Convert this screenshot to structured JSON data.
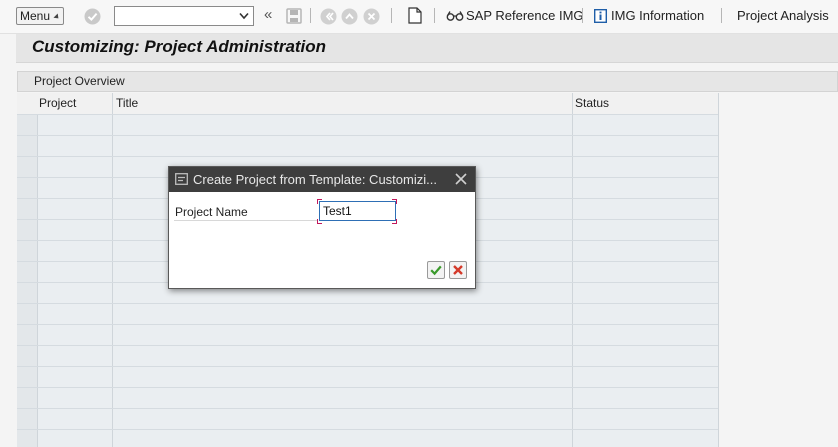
{
  "toolbar": {
    "menu_label": "Menu",
    "command_field_value": "",
    "sap_reference_label": "SAP Reference IMG",
    "img_information_label": "IMG Information",
    "project_analysis_label": "Project Analysis"
  },
  "page": {
    "title": "Customizing: Project Administration"
  },
  "overview": {
    "section_title": "Project Overview",
    "columns": [
      "Project",
      "Title",
      "Status"
    ],
    "rows": []
  },
  "dialog": {
    "title": "Create Project from Template: Customizi...",
    "field_label": "Project Name",
    "field_value": "Test1"
  },
  "colors": {
    "dialog_title_bg": "#3e3e3e",
    "ok_green": "#3a9a2b",
    "cancel_red": "#d43a2a",
    "input_focus_border": "#2e6fb5"
  }
}
